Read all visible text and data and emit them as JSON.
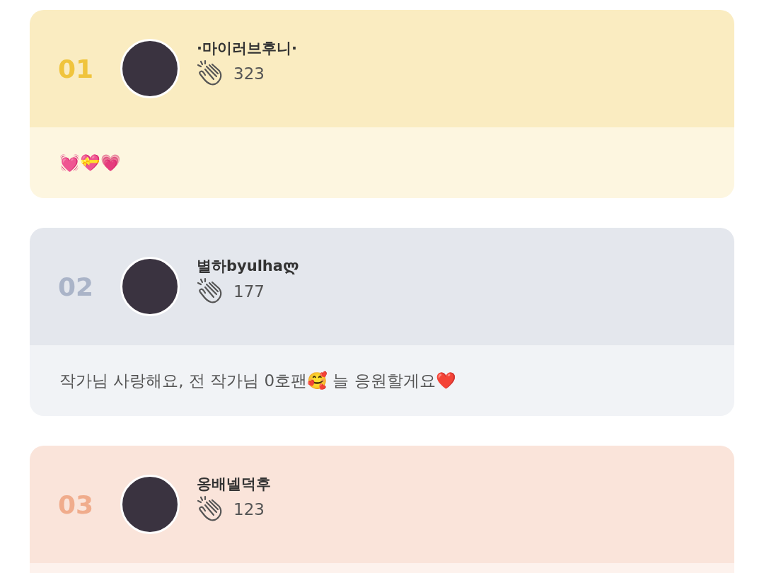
{
  "entries": [
    {
      "rank": "01",
      "color": "#f0c43c",
      "name": "·마이러브후니·",
      "claps": "323",
      "message": "💓💝💗"
    },
    {
      "rank": "02",
      "color": "#aab4c8",
      "name": "별하byulhaლ",
      "claps": "177",
      "message": "작가님 사랑해요, 전 작가님 0호팬🥰  늘 응원할게요❤️"
    },
    {
      "rank": "03",
      "color": "#f0ac8c",
      "name": "옹배넬덕후",
      "claps": "123"
    }
  ]
}
